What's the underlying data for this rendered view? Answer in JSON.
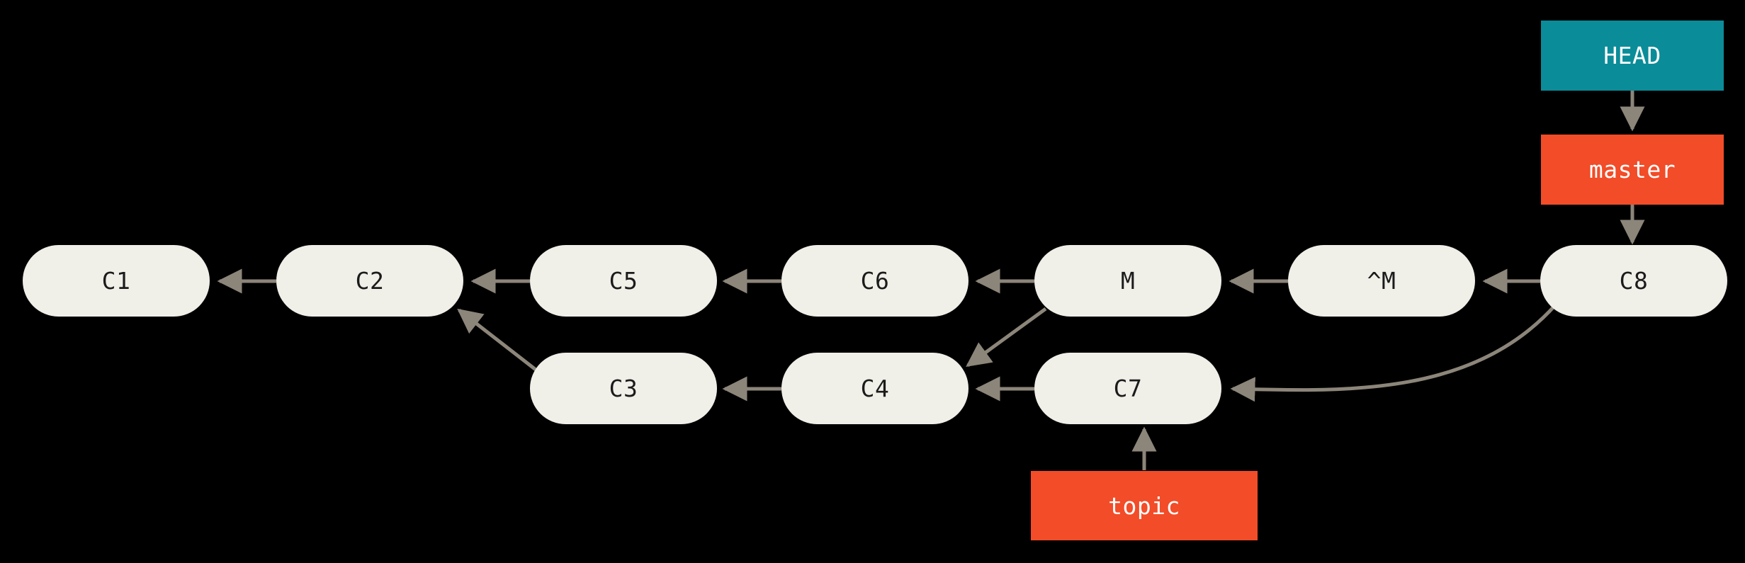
{
  "diagram": {
    "title": "git-history-merge-graph",
    "background_color": "#000000",
    "commit_fill": "#F0EFE8",
    "commit_text_color": "#1b1b1b",
    "head_color": "#0B8C99",
    "branch_color": "#F24C28",
    "edge_color": "#8C857A"
  },
  "commits": [
    {
      "id": "c1",
      "label": "C1"
    },
    {
      "id": "c2",
      "label": "C2"
    },
    {
      "id": "c5",
      "label": "C5"
    },
    {
      "id": "c6",
      "label": "C6"
    },
    {
      "id": "m",
      "label": "M"
    },
    {
      "id": "mcaret",
      "label": "^M"
    },
    {
      "id": "c8",
      "label": "C8"
    },
    {
      "id": "c3",
      "label": "C3"
    },
    {
      "id": "c4",
      "label": "C4"
    },
    {
      "id": "c7",
      "label": "C7"
    }
  ],
  "refs": [
    {
      "id": "head",
      "label": "HEAD",
      "kind": "head"
    },
    {
      "id": "master",
      "label": "master",
      "kind": "branch"
    },
    {
      "id": "topic",
      "label": "topic",
      "kind": "branch"
    }
  ],
  "edges": [
    {
      "from": "c2",
      "to": "c1"
    },
    {
      "from": "c5",
      "to": "c2"
    },
    {
      "from": "c6",
      "to": "c5"
    },
    {
      "from": "m",
      "to": "c6"
    },
    {
      "from": "mcaret",
      "to": "m"
    },
    {
      "from": "c8",
      "to": "mcaret"
    },
    {
      "from": "c3",
      "to": "c2"
    },
    {
      "from": "c4",
      "to": "c3"
    },
    {
      "from": "c7",
      "to": "c4"
    },
    {
      "from": "m",
      "to": "c4"
    },
    {
      "from": "c8",
      "to": "c7"
    },
    {
      "from": "head",
      "to": "master"
    },
    {
      "from": "master",
      "to": "c8"
    },
    {
      "from": "topic",
      "to": "c7"
    }
  ]
}
